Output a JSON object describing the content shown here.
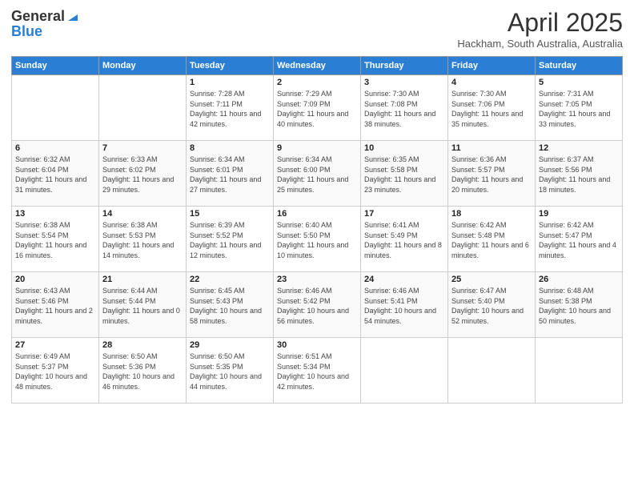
{
  "logo": {
    "general": "General",
    "blue": "Blue"
  },
  "header": {
    "title": "April 2025",
    "location": "Hackham, South Australia, Australia"
  },
  "weekdays": [
    "Sunday",
    "Monday",
    "Tuesday",
    "Wednesday",
    "Thursday",
    "Friday",
    "Saturday"
  ],
  "weeks": [
    [
      {
        "day": "",
        "detail": ""
      },
      {
        "day": "",
        "detail": ""
      },
      {
        "day": "1",
        "detail": "Sunrise: 7:28 AM\nSunset: 7:11 PM\nDaylight: 11 hours and 42 minutes."
      },
      {
        "day": "2",
        "detail": "Sunrise: 7:29 AM\nSunset: 7:09 PM\nDaylight: 11 hours and 40 minutes."
      },
      {
        "day": "3",
        "detail": "Sunrise: 7:30 AM\nSunset: 7:08 PM\nDaylight: 11 hours and 38 minutes."
      },
      {
        "day": "4",
        "detail": "Sunrise: 7:30 AM\nSunset: 7:06 PM\nDaylight: 11 hours and 35 minutes."
      },
      {
        "day": "5",
        "detail": "Sunrise: 7:31 AM\nSunset: 7:05 PM\nDaylight: 11 hours and 33 minutes."
      }
    ],
    [
      {
        "day": "6",
        "detail": "Sunrise: 6:32 AM\nSunset: 6:04 PM\nDaylight: 11 hours and 31 minutes."
      },
      {
        "day": "7",
        "detail": "Sunrise: 6:33 AM\nSunset: 6:02 PM\nDaylight: 11 hours and 29 minutes."
      },
      {
        "day": "8",
        "detail": "Sunrise: 6:34 AM\nSunset: 6:01 PM\nDaylight: 11 hours and 27 minutes."
      },
      {
        "day": "9",
        "detail": "Sunrise: 6:34 AM\nSunset: 6:00 PM\nDaylight: 11 hours and 25 minutes."
      },
      {
        "day": "10",
        "detail": "Sunrise: 6:35 AM\nSunset: 5:58 PM\nDaylight: 11 hours and 23 minutes."
      },
      {
        "day": "11",
        "detail": "Sunrise: 6:36 AM\nSunset: 5:57 PM\nDaylight: 11 hours and 20 minutes."
      },
      {
        "day": "12",
        "detail": "Sunrise: 6:37 AM\nSunset: 5:56 PM\nDaylight: 11 hours and 18 minutes."
      }
    ],
    [
      {
        "day": "13",
        "detail": "Sunrise: 6:38 AM\nSunset: 5:54 PM\nDaylight: 11 hours and 16 minutes."
      },
      {
        "day": "14",
        "detail": "Sunrise: 6:38 AM\nSunset: 5:53 PM\nDaylight: 11 hours and 14 minutes."
      },
      {
        "day": "15",
        "detail": "Sunrise: 6:39 AM\nSunset: 5:52 PM\nDaylight: 11 hours and 12 minutes."
      },
      {
        "day": "16",
        "detail": "Sunrise: 6:40 AM\nSunset: 5:50 PM\nDaylight: 11 hours and 10 minutes."
      },
      {
        "day": "17",
        "detail": "Sunrise: 6:41 AM\nSunset: 5:49 PM\nDaylight: 11 hours and 8 minutes."
      },
      {
        "day": "18",
        "detail": "Sunrise: 6:42 AM\nSunset: 5:48 PM\nDaylight: 11 hours and 6 minutes."
      },
      {
        "day": "19",
        "detail": "Sunrise: 6:42 AM\nSunset: 5:47 PM\nDaylight: 11 hours and 4 minutes."
      }
    ],
    [
      {
        "day": "20",
        "detail": "Sunrise: 6:43 AM\nSunset: 5:46 PM\nDaylight: 11 hours and 2 minutes."
      },
      {
        "day": "21",
        "detail": "Sunrise: 6:44 AM\nSunset: 5:44 PM\nDaylight: 11 hours and 0 minutes."
      },
      {
        "day": "22",
        "detail": "Sunrise: 6:45 AM\nSunset: 5:43 PM\nDaylight: 10 hours and 58 minutes."
      },
      {
        "day": "23",
        "detail": "Sunrise: 6:46 AM\nSunset: 5:42 PM\nDaylight: 10 hours and 56 minutes."
      },
      {
        "day": "24",
        "detail": "Sunrise: 6:46 AM\nSunset: 5:41 PM\nDaylight: 10 hours and 54 minutes."
      },
      {
        "day": "25",
        "detail": "Sunrise: 6:47 AM\nSunset: 5:40 PM\nDaylight: 10 hours and 52 minutes."
      },
      {
        "day": "26",
        "detail": "Sunrise: 6:48 AM\nSunset: 5:38 PM\nDaylight: 10 hours and 50 minutes."
      }
    ],
    [
      {
        "day": "27",
        "detail": "Sunrise: 6:49 AM\nSunset: 5:37 PM\nDaylight: 10 hours and 48 minutes."
      },
      {
        "day": "28",
        "detail": "Sunrise: 6:50 AM\nSunset: 5:36 PM\nDaylight: 10 hours and 46 minutes."
      },
      {
        "day": "29",
        "detail": "Sunrise: 6:50 AM\nSunset: 5:35 PM\nDaylight: 10 hours and 44 minutes."
      },
      {
        "day": "30",
        "detail": "Sunrise: 6:51 AM\nSunset: 5:34 PM\nDaylight: 10 hours and 42 minutes."
      },
      {
        "day": "",
        "detail": ""
      },
      {
        "day": "",
        "detail": ""
      },
      {
        "day": "",
        "detail": ""
      }
    ]
  ]
}
